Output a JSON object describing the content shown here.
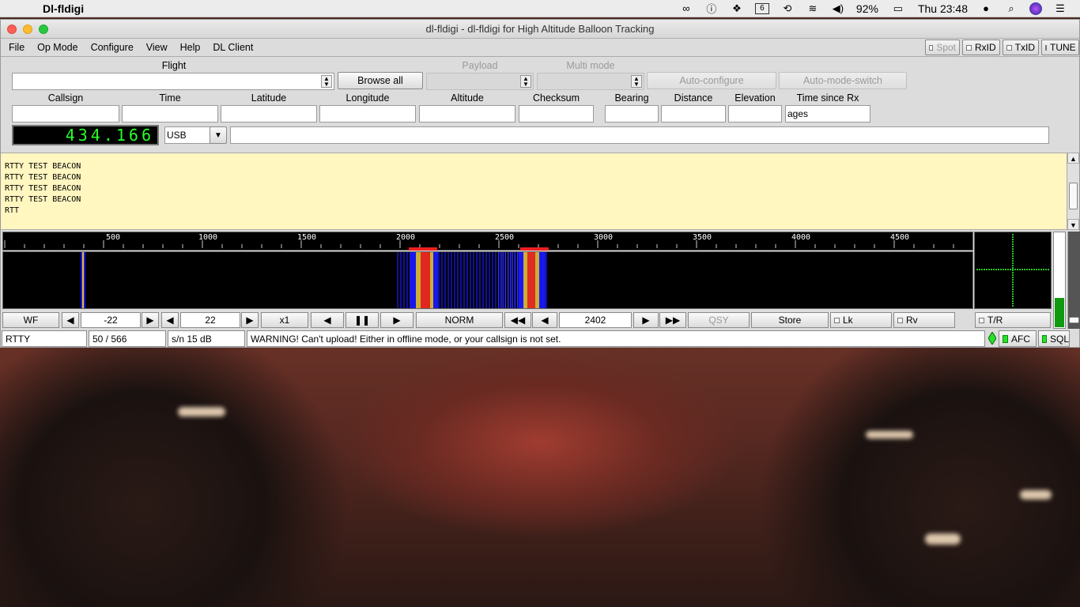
{
  "menubar": {
    "app_name": "Dl-fldigi",
    "battery": "92%",
    "clock": "Thu 23:48",
    "calendar_day": "6"
  },
  "window": {
    "title": "dl-fldigi - dl-fldigi for High Altitude Balloon Tracking"
  },
  "app_menu": [
    "File",
    "Op Mode",
    "Configure",
    "View",
    "Help",
    "DL Client"
  ],
  "top_toggles": {
    "spot": "Spot",
    "rxid": "RxID",
    "txid": "TxID",
    "tune": "TUNE"
  },
  "panel": {
    "flight_label": "Flight",
    "payload_label": "Payload",
    "multimode_label": "Multi mode",
    "browse_all": "Browse all",
    "auto_configure": "Auto-configure",
    "auto_mode_switch": "Auto-mode-switch",
    "fields": {
      "callsign": "Callsign",
      "time": "Time",
      "latitude": "Latitude",
      "longitude": "Longitude",
      "altitude": "Altitude",
      "checksum": "Checksum",
      "bearing": "Bearing",
      "distance": "Distance",
      "elevation": "Elevation",
      "time_since_rx": "Time since Rx"
    },
    "time_since_rx_value": "ages",
    "frequency": "434.166",
    "mode": "USB"
  },
  "rx_text": [
    "RTTY TEST BEACON",
    "RTTY TEST BEACON",
    "RTTY TEST BEACON",
    "RTTY TEST BEACON",
    "RTT"
  ],
  "scale_labels": [
    "500",
    "1000",
    "1500",
    "2000",
    "2500",
    "3000",
    "3500",
    "4000",
    "4500"
  ],
  "controls": {
    "wf": "WF",
    "lower": "-22",
    "upper": "22",
    "zoom": "x1",
    "norm": "NORM",
    "freq": "2402",
    "qsy": "QSY",
    "store": "Store",
    "lk": "Lk",
    "rv": "Rv",
    "tr": "T/R"
  },
  "status": {
    "mode": "RTTY",
    "counts": "50  / 566",
    "sn": "s/n  15 dB",
    "message": "WARNING! Can't upload! Either in offline mode, or your callsign is not set.",
    "afc": "AFC",
    "sql": "SQL"
  }
}
